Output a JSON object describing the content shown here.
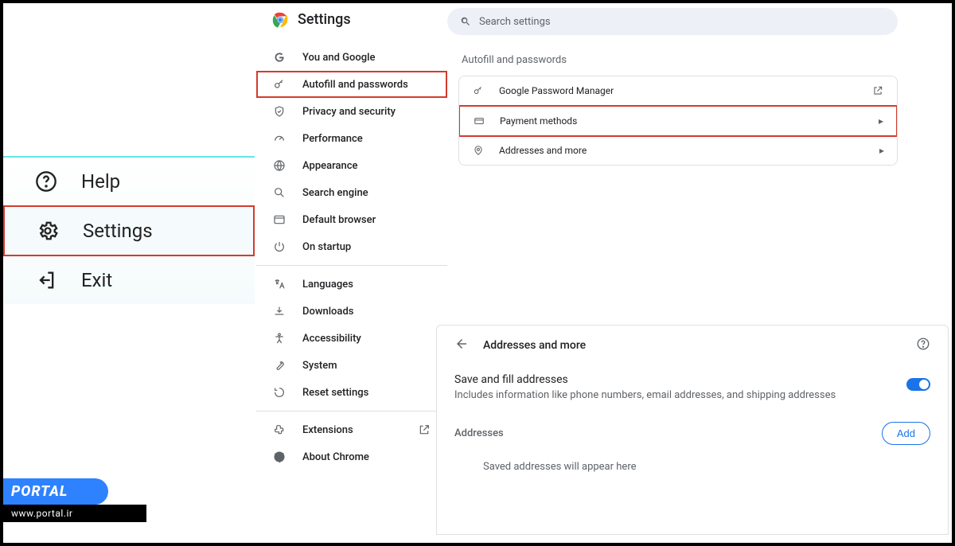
{
  "app_menu": {
    "help": "Help",
    "settings": "Settings",
    "exit": "Exit"
  },
  "header": {
    "title": "Settings"
  },
  "nav": {
    "you_google": "You and Google",
    "autofill": "Autofill and passwords",
    "privacy": "Privacy and security",
    "performance": "Performance",
    "appearance": "Appearance",
    "search_engine": "Search engine",
    "default_browser": "Default browser",
    "on_startup": "On startup",
    "languages": "Languages",
    "downloads": "Downloads",
    "accessibility": "Accessibility",
    "system": "System",
    "reset": "Reset settings",
    "extensions": "Extensions",
    "about": "About Chrome"
  },
  "search": {
    "placeholder": "Search settings"
  },
  "section": {
    "title": "Autofill and passwords"
  },
  "rows": {
    "pw_manager": "Google Password Manager",
    "payment": "Payment methods",
    "addresses": "Addresses and more"
  },
  "subpanel": {
    "title": "Addresses and more",
    "save_fill_title": "Save and fill addresses",
    "save_fill_desc": "Includes information like phone numbers, email addresses, and shipping addresses",
    "addresses_label": "Addresses",
    "add_button": "Add",
    "empty": "Saved addresses will appear here"
  },
  "portal": {
    "brand": "PORTAL",
    "url": "www.portal.ir"
  }
}
